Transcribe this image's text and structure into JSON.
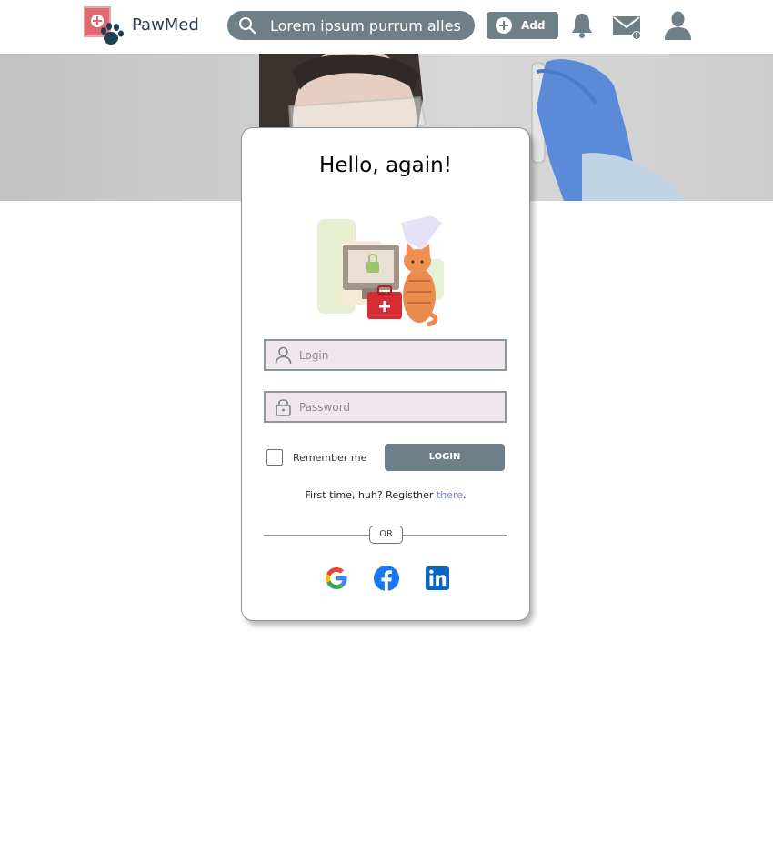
{
  "header": {
    "brand": "PawMed",
    "search_placeholder": "Lorem ipsum purrum alles",
    "add_label": "Add"
  },
  "login_card": {
    "title": "Hello, again!",
    "login_placeholder": "Login",
    "password_placeholder": "Password",
    "remember_label": "Remember me",
    "login_button": "LOGIN",
    "register_text": "First time, huh? Registher ",
    "register_link": "there",
    "register_suffix": ".",
    "or_label": "OR"
  },
  "icons": {
    "header": [
      "logo-icon",
      "search-icon",
      "add-circle-icon",
      "bell-icon",
      "mail-icon",
      "user-icon"
    ],
    "social": [
      "google-icon",
      "facebook-icon",
      "linkedin-icon"
    ]
  },
  "colors": {
    "primary": "#6f7f88",
    "input_bg": "#eee6ea",
    "link": "#7b86d6",
    "brand_text": "#2c3e50"
  }
}
